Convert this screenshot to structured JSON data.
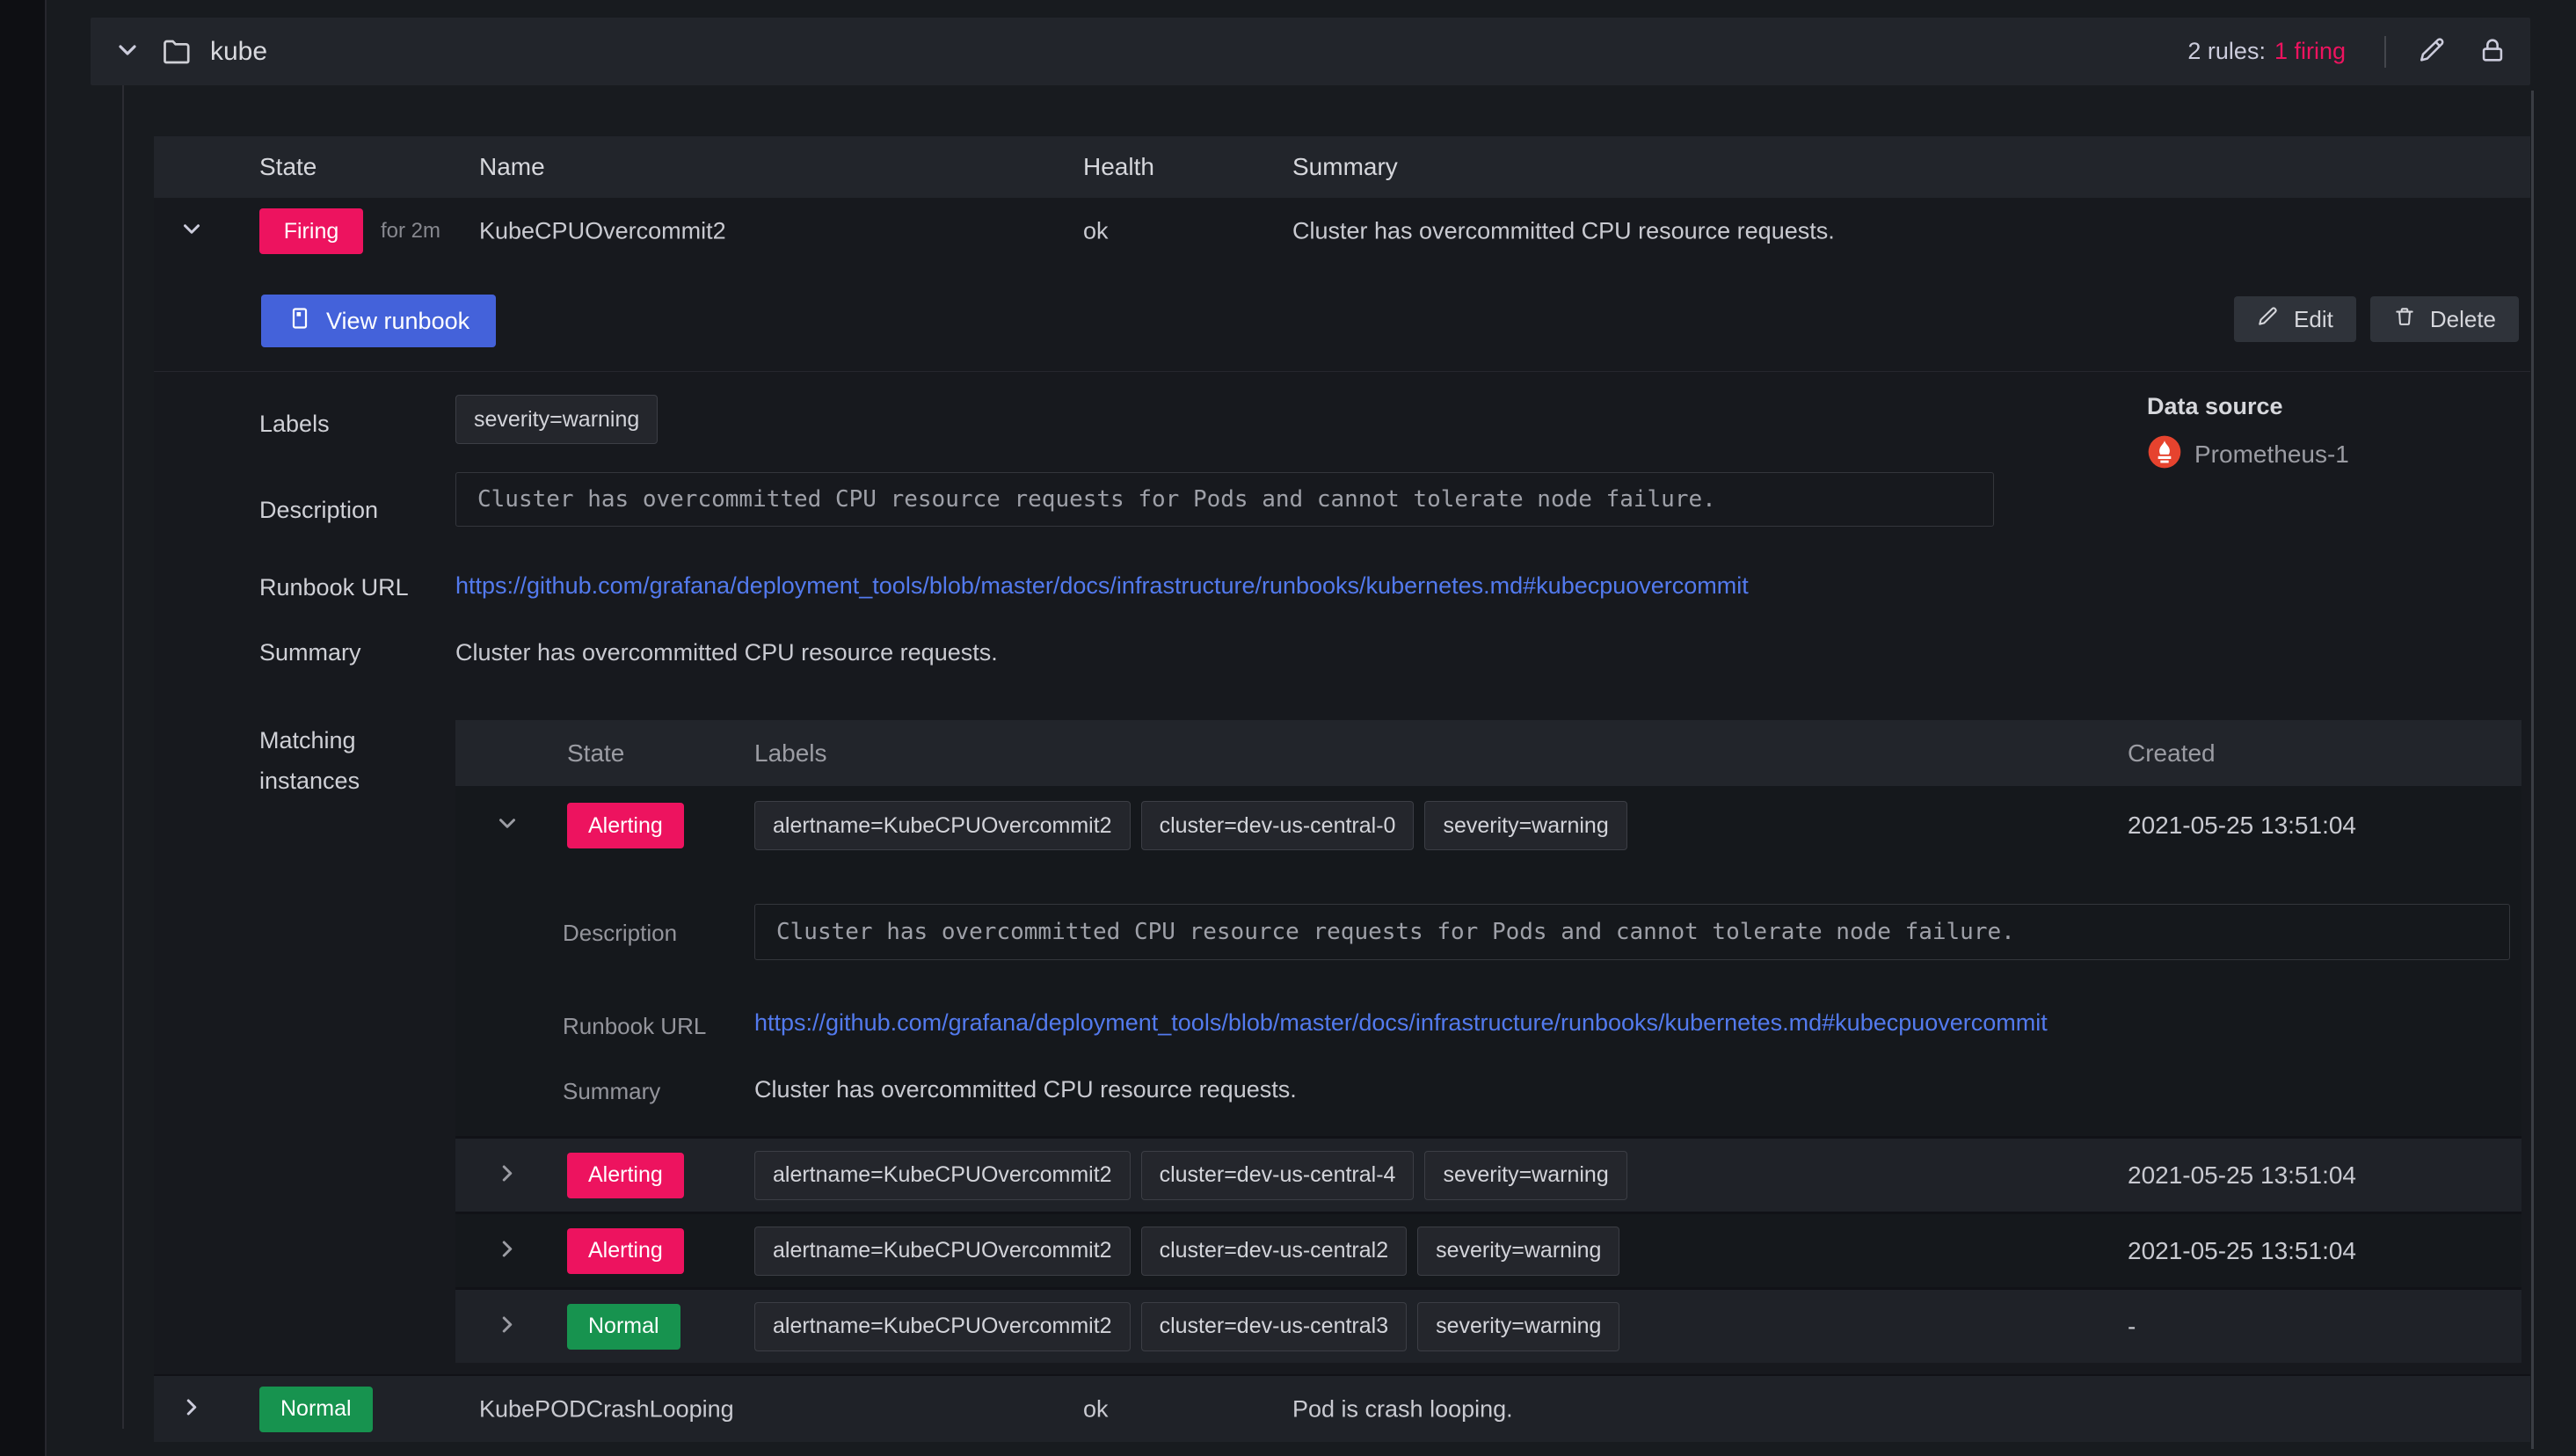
{
  "colors": {
    "firing": "#ED135F",
    "normal": "#17934F",
    "primary": "#4462DA",
    "link": "#537AEE",
    "prometheus": "#E6432E"
  },
  "folder": {
    "name": "kube",
    "rules_summary_prefix": "2 rules:",
    "rules_summary_firing": "1 firing"
  },
  "rules_table": {
    "columns": [
      "State",
      "Name",
      "Health",
      "Summary"
    ],
    "rows": [
      {
        "state": "Firing",
        "for": "for 2m",
        "name": "KubeCPUOvercommit2",
        "health": "ok",
        "summary": "Cluster has overcommitted CPU resource requests."
      },
      {
        "state": "Normal",
        "name": "KubePODCrashLooping",
        "health": "ok",
        "summary": "Pod is crash looping."
      }
    ]
  },
  "detail": {
    "view_runbook_label": "View runbook",
    "edit_label": "Edit",
    "delete_label": "Delete",
    "labels_label": "Labels",
    "labels_chips": [
      "severity=warning"
    ],
    "description_label": "Description",
    "description_value": "Cluster has overcommitted CPU resource requests for Pods and cannot tolerate node failure.",
    "runbook_label": "Runbook URL",
    "runbook_url": "https://github.com/grafana/deployment_tools/blob/master/docs/infrastructure/runbooks/kubernetes.md#kubecpuovercommit",
    "summary_label": "Summary",
    "summary_value": "Cluster has overcommitted CPU resource requests.",
    "matching_label_line1": "Matching",
    "matching_label_line2": "instances",
    "datasource_label": "Data source",
    "datasource_name": "Prometheus-1"
  },
  "instances": {
    "columns": [
      "State",
      "Labels",
      "Created"
    ],
    "rows": [
      {
        "state": "Alerting",
        "labels": [
          "alertname=KubeCPUOvercommit2",
          "cluster=dev-us-central-0",
          "severity=warning"
        ],
        "created": "2021-05-25 13:51:04"
      },
      {
        "state": "Alerting",
        "labels": [
          "alertname=KubeCPUOvercommit2",
          "cluster=dev-us-central-4",
          "severity=warning"
        ],
        "created": "2021-05-25 13:51:04"
      },
      {
        "state": "Alerting",
        "labels": [
          "alertname=KubeCPUOvercommit2",
          "cluster=dev-us-central2",
          "severity=warning"
        ],
        "created": "2021-05-25 13:51:04"
      },
      {
        "state": "Normal",
        "labels": [
          "alertname=KubeCPUOvercommit2",
          "cluster=dev-us-central3",
          "severity=warning"
        ],
        "created": "-"
      }
    ],
    "detail": {
      "description_label": "Description",
      "description_value": "Cluster has overcommitted CPU resource requests for Pods and cannot tolerate node failure.",
      "runbook_label": "Runbook URL",
      "runbook_url": "https://github.com/grafana/deployment_tools/blob/master/docs/infrastructure/runbooks/kubernetes.md#kubecpuovercommit",
      "summary_label": "Summary",
      "summary_value": "Cluster has overcommitted CPU resource requests."
    }
  }
}
